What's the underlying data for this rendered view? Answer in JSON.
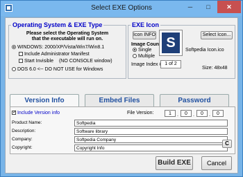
{
  "window": {
    "title": "Select EXE Options"
  },
  "titlebar": {
    "minimize": "─",
    "maximize": "□",
    "close": "✕"
  },
  "os_group": {
    "title": "Operating System & EXE Type",
    "instruction_line1": "Please select the Operating System",
    "instruction_line2": "that the executable will run on.",
    "windows_option": "WINDOWS: 2000/XP/Vista/Win7/Win8.1",
    "admin_manifest": "Include Administrator Manifest",
    "start_invisible": "Start Invisible",
    "no_console_note": "(NO CONSOLE window)",
    "dos_option": "DOS 6.0 <-- DO NOT USE for Windows"
  },
  "icon_group": {
    "title": "EXE Icon",
    "icon_info_button": "Icon INFO",
    "select_icon_button": "Select Icon...",
    "image_count_label": "Image Count",
    "single_option": "Single",
    "multiple_option": "Multiple",
    "image_index_label": "Image Index #",
    "image_index_value": "1 of 2",
    "icon_letter": "S",
    "filename": "Softpedia Icon.ico",
    "size": "Size: 48x48"
  },
  "tabs": [
    {
      "label": "Version Info"
    },
    {
      "label": "Embed Files"
    },
    {
      "label": "Password"
    }
  ],
  "version_info": {
    "include_label": "Include Version info",
    "file_version_label": "File Version:",
    "file_version": [
      "1",
      "0",
      "0",
      "0"
    ],
    "fields": [
      {
        "label": "Product Name:",
        "value": "Softpedia"
      },
      {
        "label": "Description:",
        "value": "Software library"
      },
      {
        "label": "Company:",
        "value": "Softpedia Company"
      },
      {
        "label": "Copyright:",
        "value": "Copyright Info"
      }
    ],
    "copyright_button": "C"
  },
  "footer": {
    "build_button": "Build EXE",
    "cancel_button": "Cancel"
  },
  "colors": {
    "accent": "#0000c8",
    "titlebar": "#7ab8ee",
    "icon_bg": "#1e3f78"
  }
}
